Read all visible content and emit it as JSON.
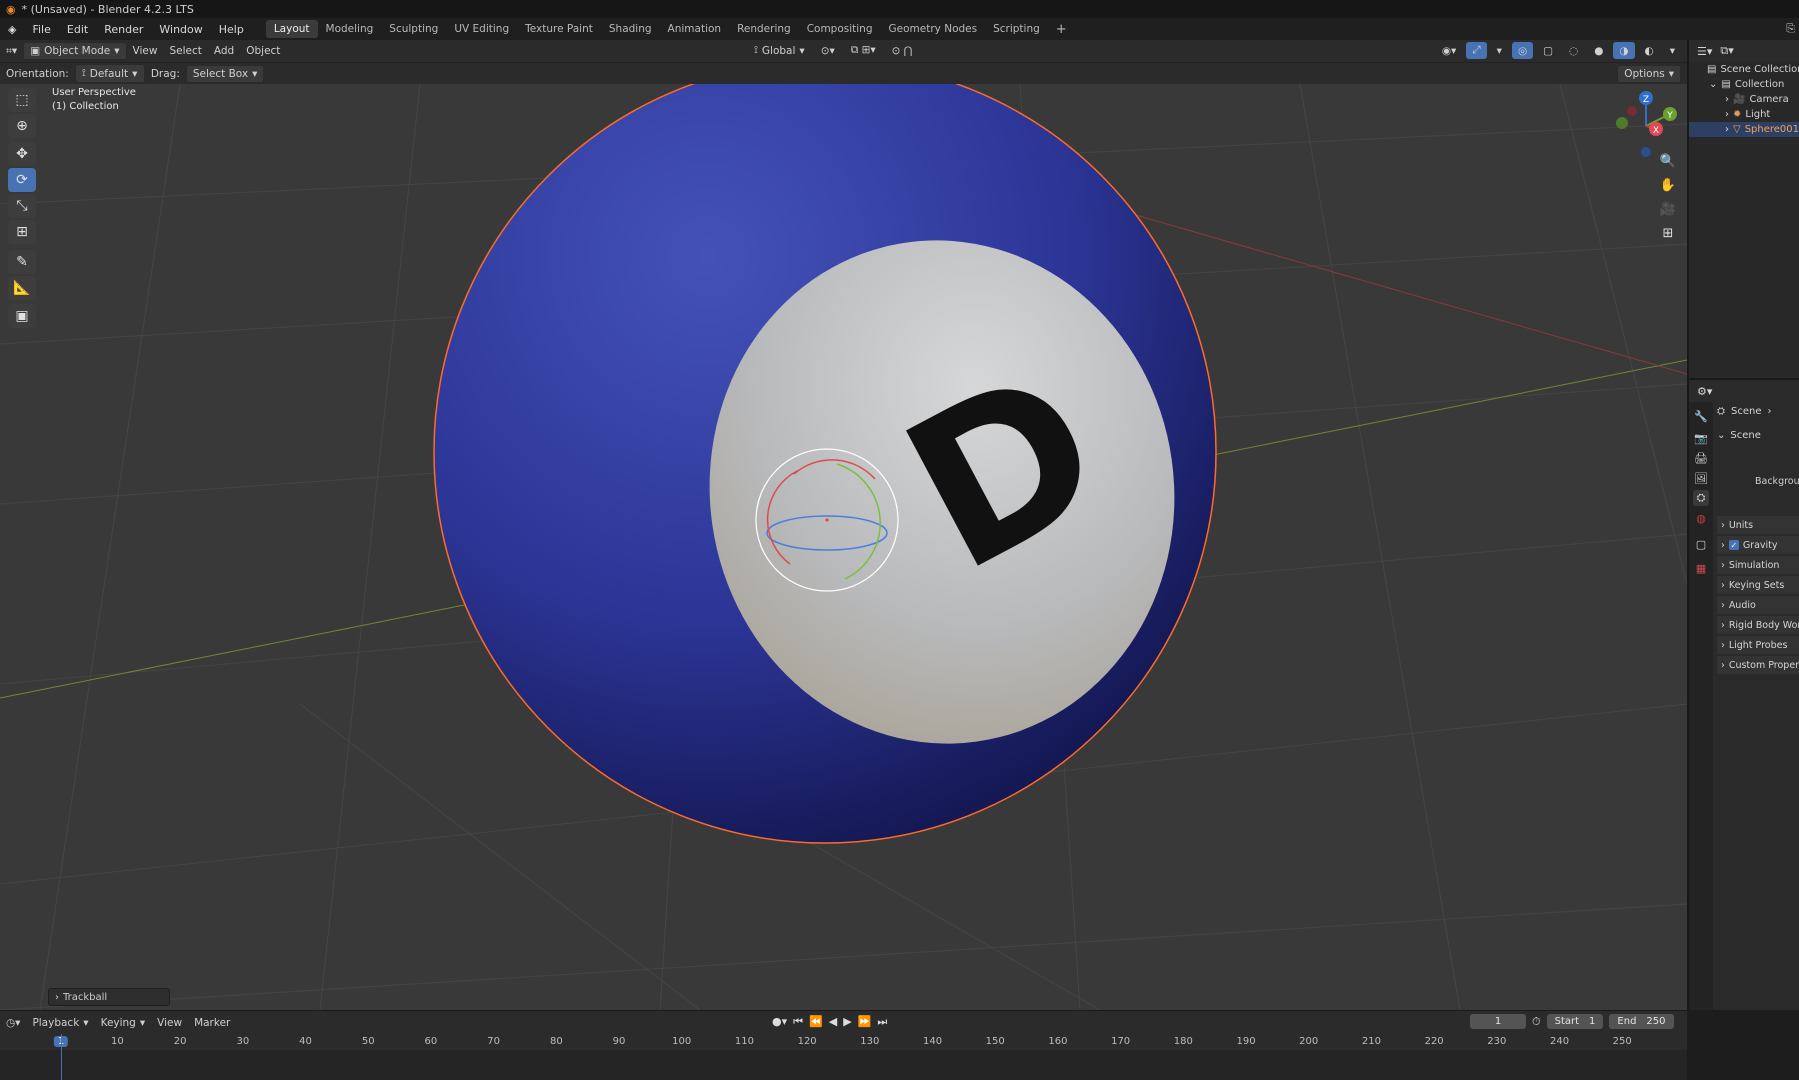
{
  "title_bar": {
    "title": "* (Unsaved) - Blender 4.2.3 LTS"
  },
  "menu": [
    "File",
    "Edit",
    "Render",
    "Window",
    "Help"
  ],
  "workspaces": [
    {
      "label": "Layout",
      "active": true
    },
    {
      "label": "Modeling"
    },
    {
      "label": "Sculpting"
    },
    {
      "label": "UV Editing"
    },
    {
      "label": "Texture Paint"
    },
    {
      "label": "Shading"
    },
    {
      "label": "Animation"
    },
    {
      "label": "Rendering"
    },
    {
      "label": "Compositing"
    },
    {
      "label": "Geometry Nodes"
    },
    {
      "label": "Scripting"
    }
  ],
  "add_workspace": "+",
  "viewport_header": {
    "mode": "Object Mode",
    "menus": [
      "View",
      "Select",
      "Add",
      "Object"
    ],
    "transform_orientation": "Global"
  },
  "tool_header": {
    "orientation_label": "Orientation:",
    "orientation_value": "Default",
    "drag_label": "Drag:",
    "drag_value": "Select Box",
    "options": "Options"
  },
  "viewport": {
    "perspective": "User Perspective",
    "collection": "(1) Collection",
    "ball_label": "D",
    "ball_colors": {
      "blue": "#3b46a8",
      "white": "#c9c8c4",
      "outline": "#ff6a2a"
    },
    "gizmo_axes": {
      "x": "X",
      "y": "Y",
      "z": "Z"
    },
    "last_operator": "Trackball"
  },
  "outliner": {
    "items": [
      {
        "label": "Scene Collection",
        "icon": "scene-collection-icon"
      },
      {
        "label": "Collection",
        "icon": "collection-icon"
      },
      {
        "label": "Camera",
        "icon": "camera-icon"
      },
      {
        "label": "Light",
        "icon": "light-icon"
      },
      {
        "label": "Sphere001",
        "icon": "mesh-icon",
        "selected": true
      }
    ]
  },
  "properties": {
    "breadcrumb": "Scene",
    "panel_title": "Scene",
    "background_label": "Backgrou",
    "panels": [
      "Units",
      "Gravity",
      "Simulation",
      "Keying Sets",
      "Audio",
      "Rigid Body World",
      "Light Probes",
      "Custom Properties"
    ],
    "gravity_checked": true
  },
  "timeline": {
    "menus": [
      "Playback",
      "Keying",
      "View",
      "Marker"
    ],
    "current_frame": "1",
    "start_label": "Start",
    "start_value": "1",
    "end_label": "End",
    "end_value": "250",
    "ticks": [
      "1",
      "10",
      "20",
      "30",
      "40",
      "50",
      "60",
      "70",
      "80",
      "90",
      "100",
      "110",
      "120",
      "130",
      "140",
      "150",
      "160",
      "170",
      "180",
      "190",
      "200",
      "210",
      "220",
      "230",
      "240",
      "250"
    ]
  }
}
